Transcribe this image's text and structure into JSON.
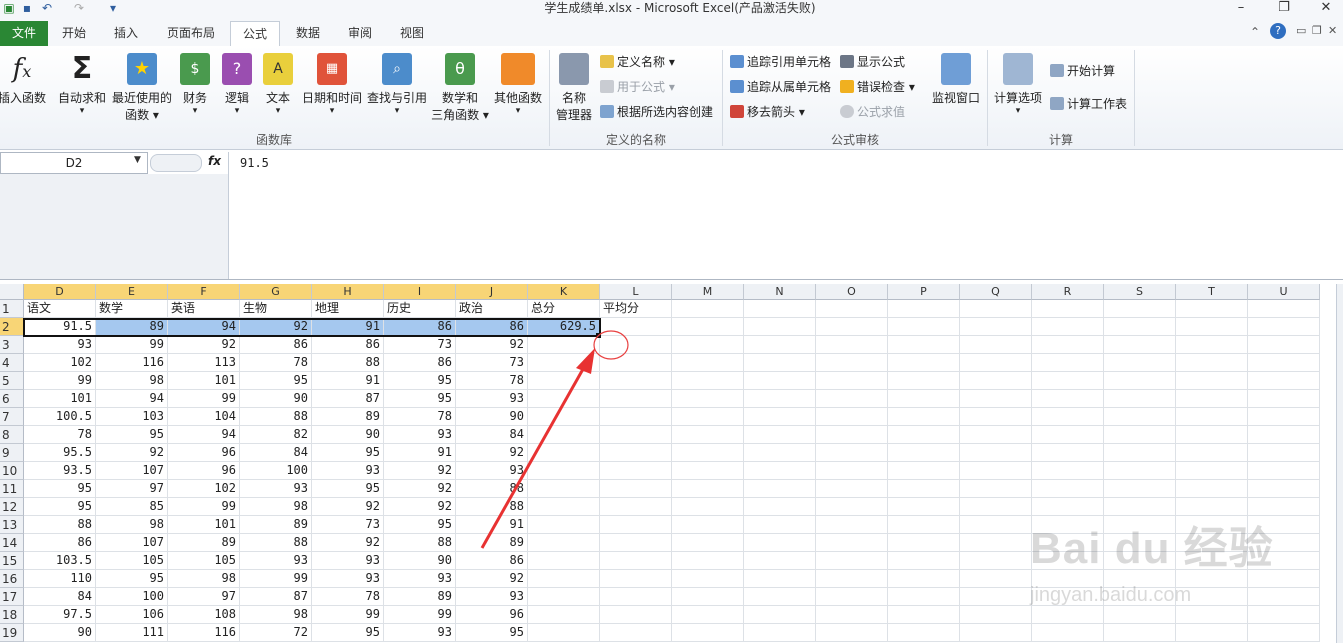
{
  "window": {
    "title": "学生成绩单.xlsx  -  Microsoft Excel(产品激活失败)"
  },
  "tabs": [
    "文件",
    "开始",
    "插入",
    "页面布局",
    "公式",
    "数据",
    "审阅",
    "视图"
  ],
  "active_tab": "公式",
  "ribbon": {
    "function_library": {
      "label": "函数库",
      "buttons": [
        {
          "name": "insert-function",
          "line1": "插入函数",
          "line2": ""
        },
        {
          "name": "autosum",
          "line1": "自动求和",
          "line2": "▾"
        },
        {
          "name": "recent",
          "line1": "最近使用的",
          "line2": "函数 ▾"
        },
        {
          "name": "financial",
          "line1": "财务",
          "line2": "▾"
        },
        {
          "name": "logical",
          "line1": "逻辑",
          "line2": "▾"
        },
        {
          "name": "text",
          "line1": "文本",
          "line2": "▾"
        },
        {
          "name": "datetime",
          "line1": "日期和时间",
          "line2": "▾"
        },
        {
          "name": "lookup",
          "line1": "查找与引用",
          "line2": "▾"
        },
        {
          "name": "math",
          "line1": "数学和",
          "line2": "三角函数 ▾"
        },
        {
          "name": "other",
          "line1": "其他函数",
          "line2": "▾"
        }
      ]
    },
    "defined_names": {
      "label": "定义的名称",
      "name_manager": {
        "line1": "名称",
        "line2": "管理器"
      },
      "define_name": "定义名称 ▾",
      "use_in_formula": "用于公式 ▾",
      "create_from_selection": "根据所选内容创建"
    },
    "formula_auditing": {
      "label": "公式审核",
      "trace_precedents": "追踪引用单元格",
      "trace_dependents": "追踪从属单元格",
      "remove_arrows": "移去箭头 ▾",
      "show_formulas": "显示公式",
      "error_checking": "错误检查 ▾",
      "evaluate_formula": "公式求值",
      "watch_window": "监视窗口"
    },
    "calculation": {
      "label": "计算",
      "calc_options": "计算选项",
      "calc_now": "开始计算",
      "calc_sheet": "计算工作表"
    }
  },
  "formula_bar": {
    "name_box": "D2",
    "fx": "fx",
    "value": "91.5"
  },
  "sheet": {
    "columns": [
      "D",
      "E",
      "F",
      "G",
      "H",
      "I",
      "J",
      "K",
      "L",
      "M",
      "N",
      "O",
      "P",
      "Q",
      "R",
      "S",
      "T",
      "U"
    ],
    "row_numbers": [
      "1",
      "2",
      "3",
      "4",
      "5",
      "6",
      "7",
      "8",
      "9",
      "10",
      "11",
      "12",
      "13",
      "14",
      "15",
      "16",
      "17",
      "18",
      "19"
    ],
    "headers": [
      "语文",
      "数学",
      "英语",
      "生物",
      "地理",
      "历史",
      "政治",
      "总分",
      "平均分"
    ],
    "rows": [
      [
        "91.5",
        "89",
        "94",
        "92",
        "91",
        "86",
        "86",
        "629.5"
      ],
      [
        "93",
        "99",
        "92",
        "86",
        "86",
        "73",
        "92"
      ],
      [
        "102",
        "116",
        "113",
        "78",
        "88",
        "86",
        "73"
      ],
      [
        "99",
        "98",
        "101",
        "95",
        "91",
        "95",
        "78"
      ],
      [
        "101",
        "94",
        "99",
        "90",
        "87",
        "95",
        "93"
      ],
      [
        "100.5",
        "103",
        "104",
        "88",
        "89",
        "78",
        "90"
      ],
      [
        "78",
        "95",
        "94",
        "82",
        "90",
        "93",
        "84"
      ],
      [
        "95.5",
        "92",
        "96",
        "84",
        "95",
        "91",
        "92"
      ],
      [
        "93.5",
        "107",
        "96",
        "100",
        "93",
        "92",
        "93"
      ],
      [
        "95",
        "97",
        "102",
        "93",
        "95",
        "92",
        "88"
      ],
      [
        "95",
        "85",
        "99",
        "98",
        "92",
        "92",
        "88"
      ],
      [
        "88",
        "98",
        "101",
        "89",
        "73",
        "95",
        "91"
      ],
      [
        "86",
        "107",
        "89",
        "88",
        "92",
        "88",
        "89"
      ],
      [
        "103.5",
        "105",
        "105",
        "93",
        "93",
        "90",
        "86"
      ],
      [
        "110",
        "95",
        "98",
        "99",
        "93",
        "93",
        "92"
      ],
      [
        "84",
        "100",
        "97",
        "87",
        "78",
        "89",
        "93"
      ],
      [
        "97.5",
        "106",
        "108",
        "98",
        "99",
        "99",
        "96"
      ],
      [
        "90",
        "111",
        "116",
        "72",
        "95",
        "93",
        "95"
      ]
    ]
  },
  "watermark": {
    "brand": "Bai du 经验",
    "url": "jingyan.baidu.com"
  }
}
